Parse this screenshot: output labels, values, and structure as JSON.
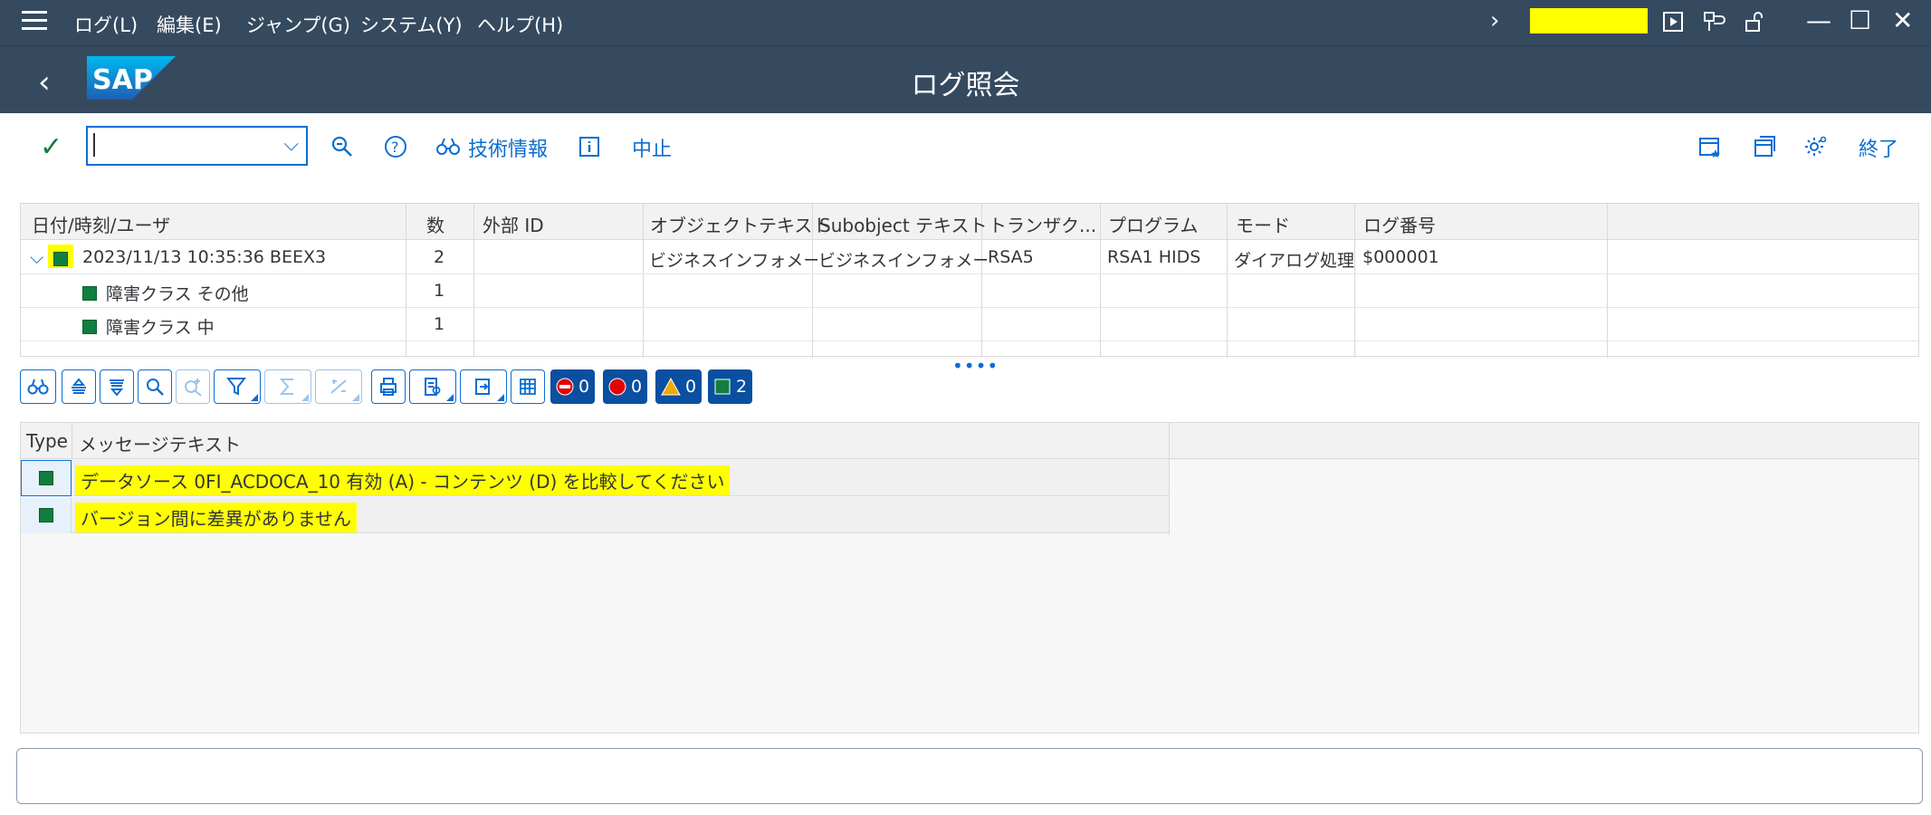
{
  "menubar": {
    "items": [
      "ログ(L)",
      "編集(E)",
      "ジャンプ(G)",
      "システム(Y)",
      "ヘルプ(H)"
    ]
  },
  "shell": {
    "title": "ログ照会",
    "logo_text": "SAP"
  },
  "toolbar": {
    "command_value": "",
    "tech_info_label": "技術情報",
    "cancel_label": "中止",
    "exit_label": "終了"
  },
  "log_table": {
    "columns": [
      "日付/時刻/ユーザ",
      "数",
      "外部 ID",
      "オブジェクトテキスト",
      "Subobject テキスト",
      "トランザク...",
      "プログラム",
      "モード",
      "ログ番号"
    ],
    "rows": [
      {
        "date_user": "2023/11/13  10:35:36  BEEX3",
        "count": "2",
        "external_id": "",
        "object_text": "ビジネスインフォメーシ",
        "subobject_text": "ビジネスインフォメーシ",
        "transaction": "RSA5",
        "program": "RSA1 HIDS",
        "mode": "ダイアログ処理",
        "log_number": "$000001"
      },
      {
        "label": "障害クラス その他",
        "count": "1"
      },
      {
        "label": "障害クラス 中",
        "count": "1"
      }
    ]
  },
  "message_toolbar": {
    "error_count": "0",
    "error2_count": "0",
    "warning_count": "0",
    "success_count": "2"
  },
  "messages": {
    "columns": [
      "Type",
      "メッセージテキスト"
    ],
    "rows": [
      {
        "type": "success",
        "text": "データソース 0FI_ACDOCA_10 有効 (A) - コンテンツ (D) を比較してください"
      },
      {
        "type": "success",
        "text": "バージョン間に差異がありません"
      }
    ]
  },
  "colors": {
    "shell": "#354a5f",
    "accent": "#0a6ed1",
    "success": "#107e3e",
    "highlight": "#ffff00"
  }
}
